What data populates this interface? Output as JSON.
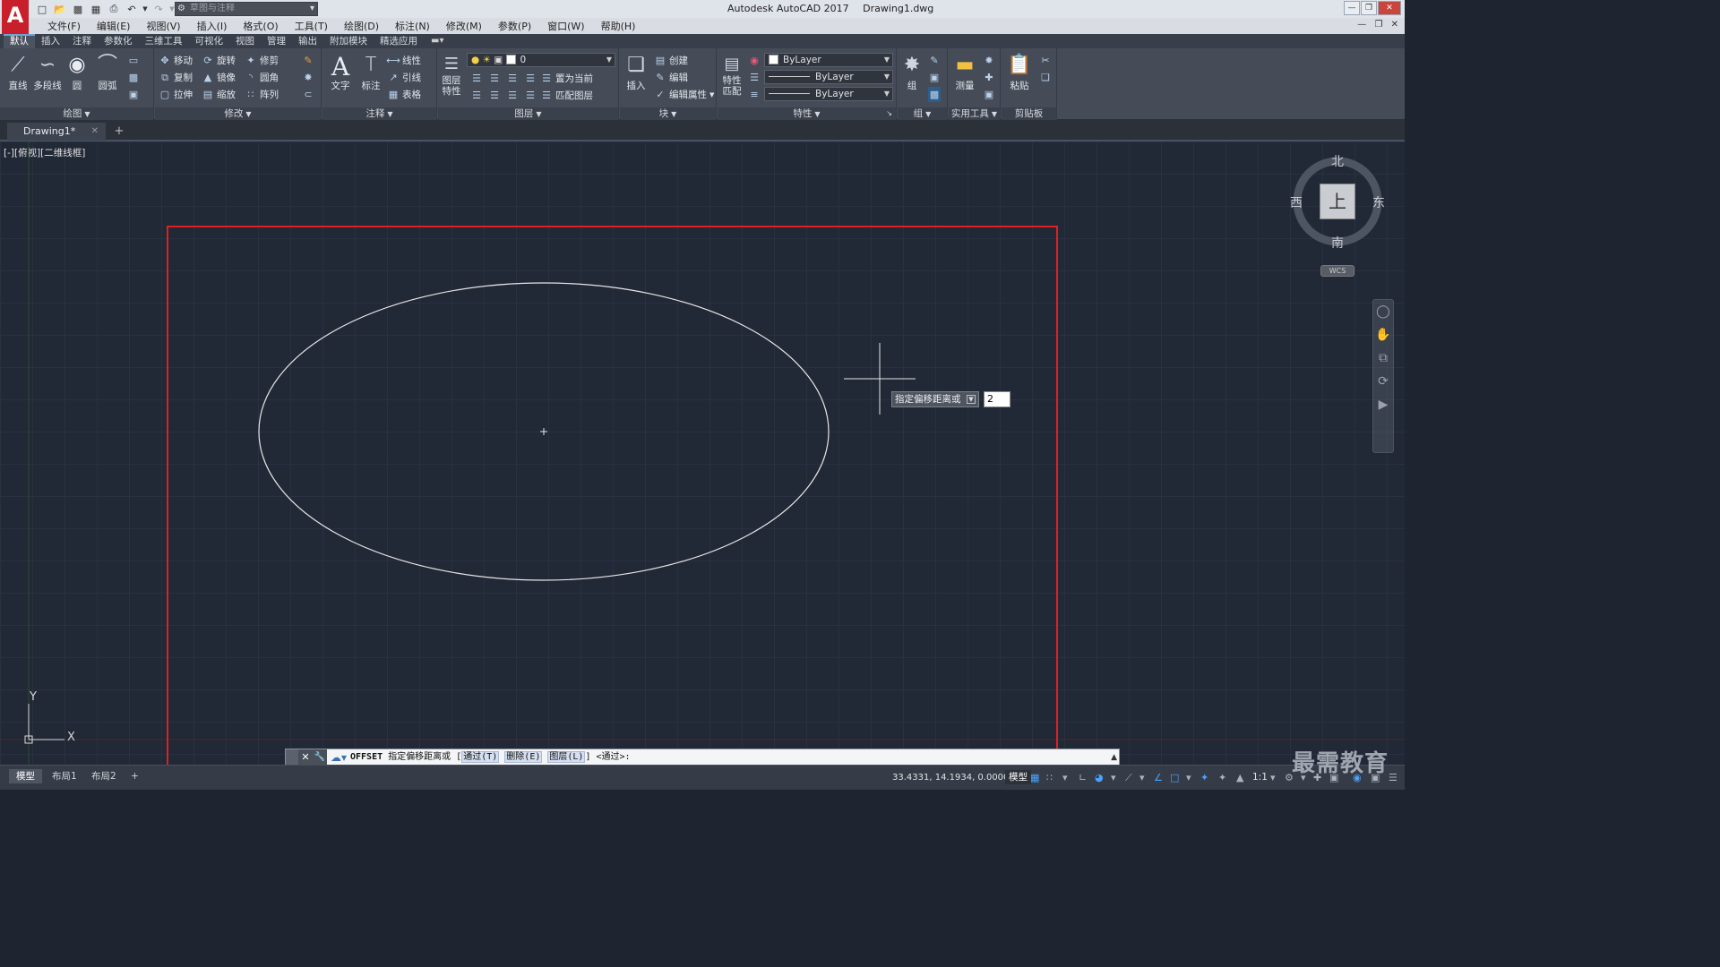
{
  "app": {
    "logo": "A",
    "title": "Autodesk AutoCAD 2017",
    "filename": "Drawing1.dwg",
    "workspace": "草图与注释"
  },
  "menu": [
    "文件(F)",
    "编辑(E)",
    "视图(V)",
    "插入(I)",
    "格式(O)",
    "工具(T)",
    "绘图(D)",
    "标注(N)",
    "修改(M)",
    "参数(P)",
    "窗口(W)",
    "帮助(H)"
  ],
  "ribbon_tabs": [
    "默认",
    "插入",
    "注释",
    "参数化",
    "三维工具",
    "可视化",
    "视图",
    "管理",
    "输出",
    "附加模块",
    "精选应用"
  ],
  "ribbon": {
    "draw": {
      "title": "绘图",
      "line": "直线",
      "polyline": "多段线",
      "circle": "圆",
      "arc": "圆弧"
    },
    "modify": {
      "title": "修改",
      "move": "移动",
      "rotate": "旋转",
      "trim": "修剪",
      "copy": "复制",
      "mirror": "镜像",
      "fillet": "圆角",
      "stretch": "拉伸",
      "scale": "缩放",
      "array": "阵列"
    },
    "annotation": {
      "title": "注释",
      "text": "文字",
      "dimension": "标注",
      "linear": "线性",
      "leader": "引线",
      "table": "表格"
    },
    "layers": {
      "title": "图层",
      "layer_props_1": "图层",
      "layer_props_2": "特性",
      "current_layer": "0",
      "set_current": "置为当前",
      "match_layer": "匹配图层"
    },
    "block": {
      "title": "块",
      "insert": "插入",
      "create": "创建",
      "edit": "编辑",
      "edit_attr": "编辑属性"
    },
    "properties": {
      "title": "特性",
      "match_1": "特性",
      "match_2": "匹配",
      "color": "ByLayer",
      "linetype": "ByLayer",
      "lineweight": "ByLayer"
    },
    "groups": {
      "title": "组",
      "group": "组"
    },
    "utilities": {
      "title": "实用工具",
      "measure": "测量"
    },
    "clipboard": {
      "title": "剪贴板",
      "paste": "粘贴"
    }
  },
  "file_tab": {
    "name": "Drawing1*"
  },
  "viewport_label": "[-][俯视][二维线框]",
  "viewcube": {
    "north": "北",
    "south": "南",
    "east": "东",
    "west": "西",
    "top": "上",
    "wcs": "WCS"
  },
  "ucs": {
    "x": "X",
    "y": "Y"
  },
  "dynamic_input": {
    "prompt": "指定偏移距离或",
    "value": "2"
  },
  "command_line": {
    "command": "OFFSET",
    "prompt": "指定偏移距离或",
    "options": [
      "通过(T)",
      "删除(E)",
      "图层(L)"
    ],
    "default": "<通过>:"
  },
  "layout_tabs": [
    "模型",
    "布局1",
    "布局2"
  ],
  "status": {
    "coords": "33.4331, 14.1934, 0.0000",
    "mode": "模型",
    "scale": "1:1"
  },
  "watermark": "最需教育",
  "colors": {
    "canvas": "#212836",
    "highlight_rect": "#e02020",
    "ellipse": "#e6e6e6"
  }
}
